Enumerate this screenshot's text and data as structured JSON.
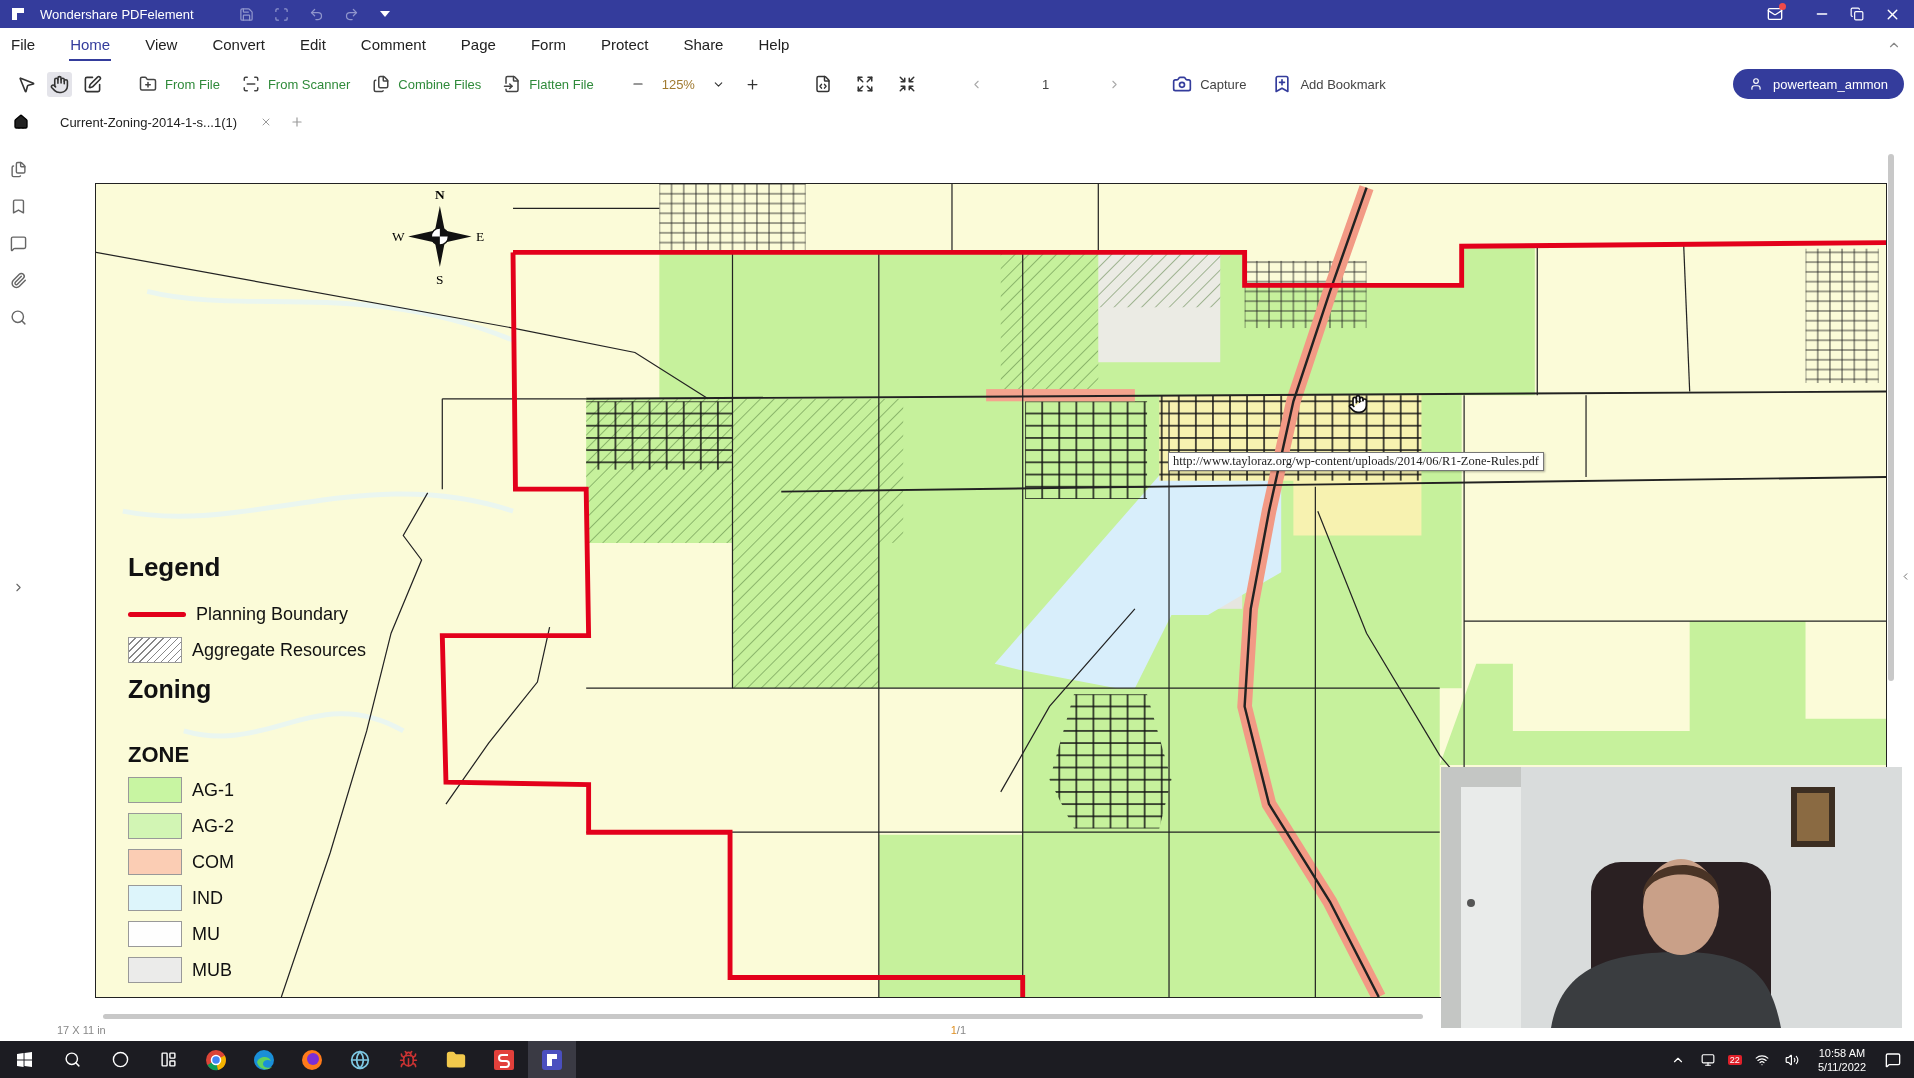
{
  "window": {
    "title": "Wondershare PDFelement",
    "notification": true
  },
  "menu": [
    {
      "label": "File",
      "selected": false
    },
    {
      "label": "Home",
      "selected": true
    },
    {
      "label": "View",
      "selected": false
    },
    {
      "label": "Convert",
      "selected": false
    },
    {
      "label": "Edit",
      "selected": false
    },
    {
      "label": "Comment",
      "selected": false
    },
    {
      "label": "Page",
      "selected": false
    },
    {
      "label": "Form",
      "selected": false
    },
    {
      "label": "Protect",
      "selected": false
    },
    {
      "label": "Share",
      "selected": false
    },
    {
      "label": "Help",
      "selected": false
    }
  ],
  "toolbar": {
    "tools": [
      {
        "kind": "select",
        "selected": false
      },
      {
        "kind": "hand",
        "selected": true
      },
      {
        "kind": "edit",
        "selected": false
      }
    ],
    "create": [
      {
        "kind": "folder",
        "label": "From File"
      },
      {
        "kind": "scanner",
        "label": "From Scanner"
      },
      {
        "kind": "combine",
        "label": "Combine Files"
      },
      {
        "kind": "flatten",
        "label": "Flatten File"
      }
    ],
    "zoom": "125%",
    "page": "1",
    "capture": "Capture",
    "bookmark": "Add Bookmark",
    "user": "powerteam_ammon"
  },
  "tabs": [
    {
      "label": "Current-Zoning-2014-1-s...1(1)",
      "selected": true
    }
  ],
  "map": {
    "compass": {
      "n": "N",
      "w": "W",
      "e": "E",
      "s": "S"
    },
    "legend": {
      "title": "Legend",
      "boundary": "Planning Boundary",
      "aggregate": "Aggregate Resources",
      "zoning": "Zoning",
      "zone_heading": "ZONE",
      "zones": [
        {
          "label": "AG-1",
          "color": "#c8f5a2"
        },
        {
          "label": "AG-2",
          "color": "#d2f5b4"
        },
        {
          "label": "COM",
          "color": "#fbcdb4"
        },
        {
          "label": "IND",
          "color": "#ddf5fb"
        },
        {
          "label": "MU",
          "color": "#fefefe"
        },
        {
          "label": "MUB",
          "color": "#ebebea"
        }
      ]
    },
    "tooltip": "http://www.tayloraz.org/wp-content/uploads/2014/06/R1-Zone-Rules.pdf"
  },
  "status_bar": {
    "size": "17 X 11 in",
    "page_current": "1",
    "page_total": "/1"
  },
  "taskbar": {
    "badge": "22",
    "time": "10:58 AM",
    "date": "5/11/2022"
  }
}
